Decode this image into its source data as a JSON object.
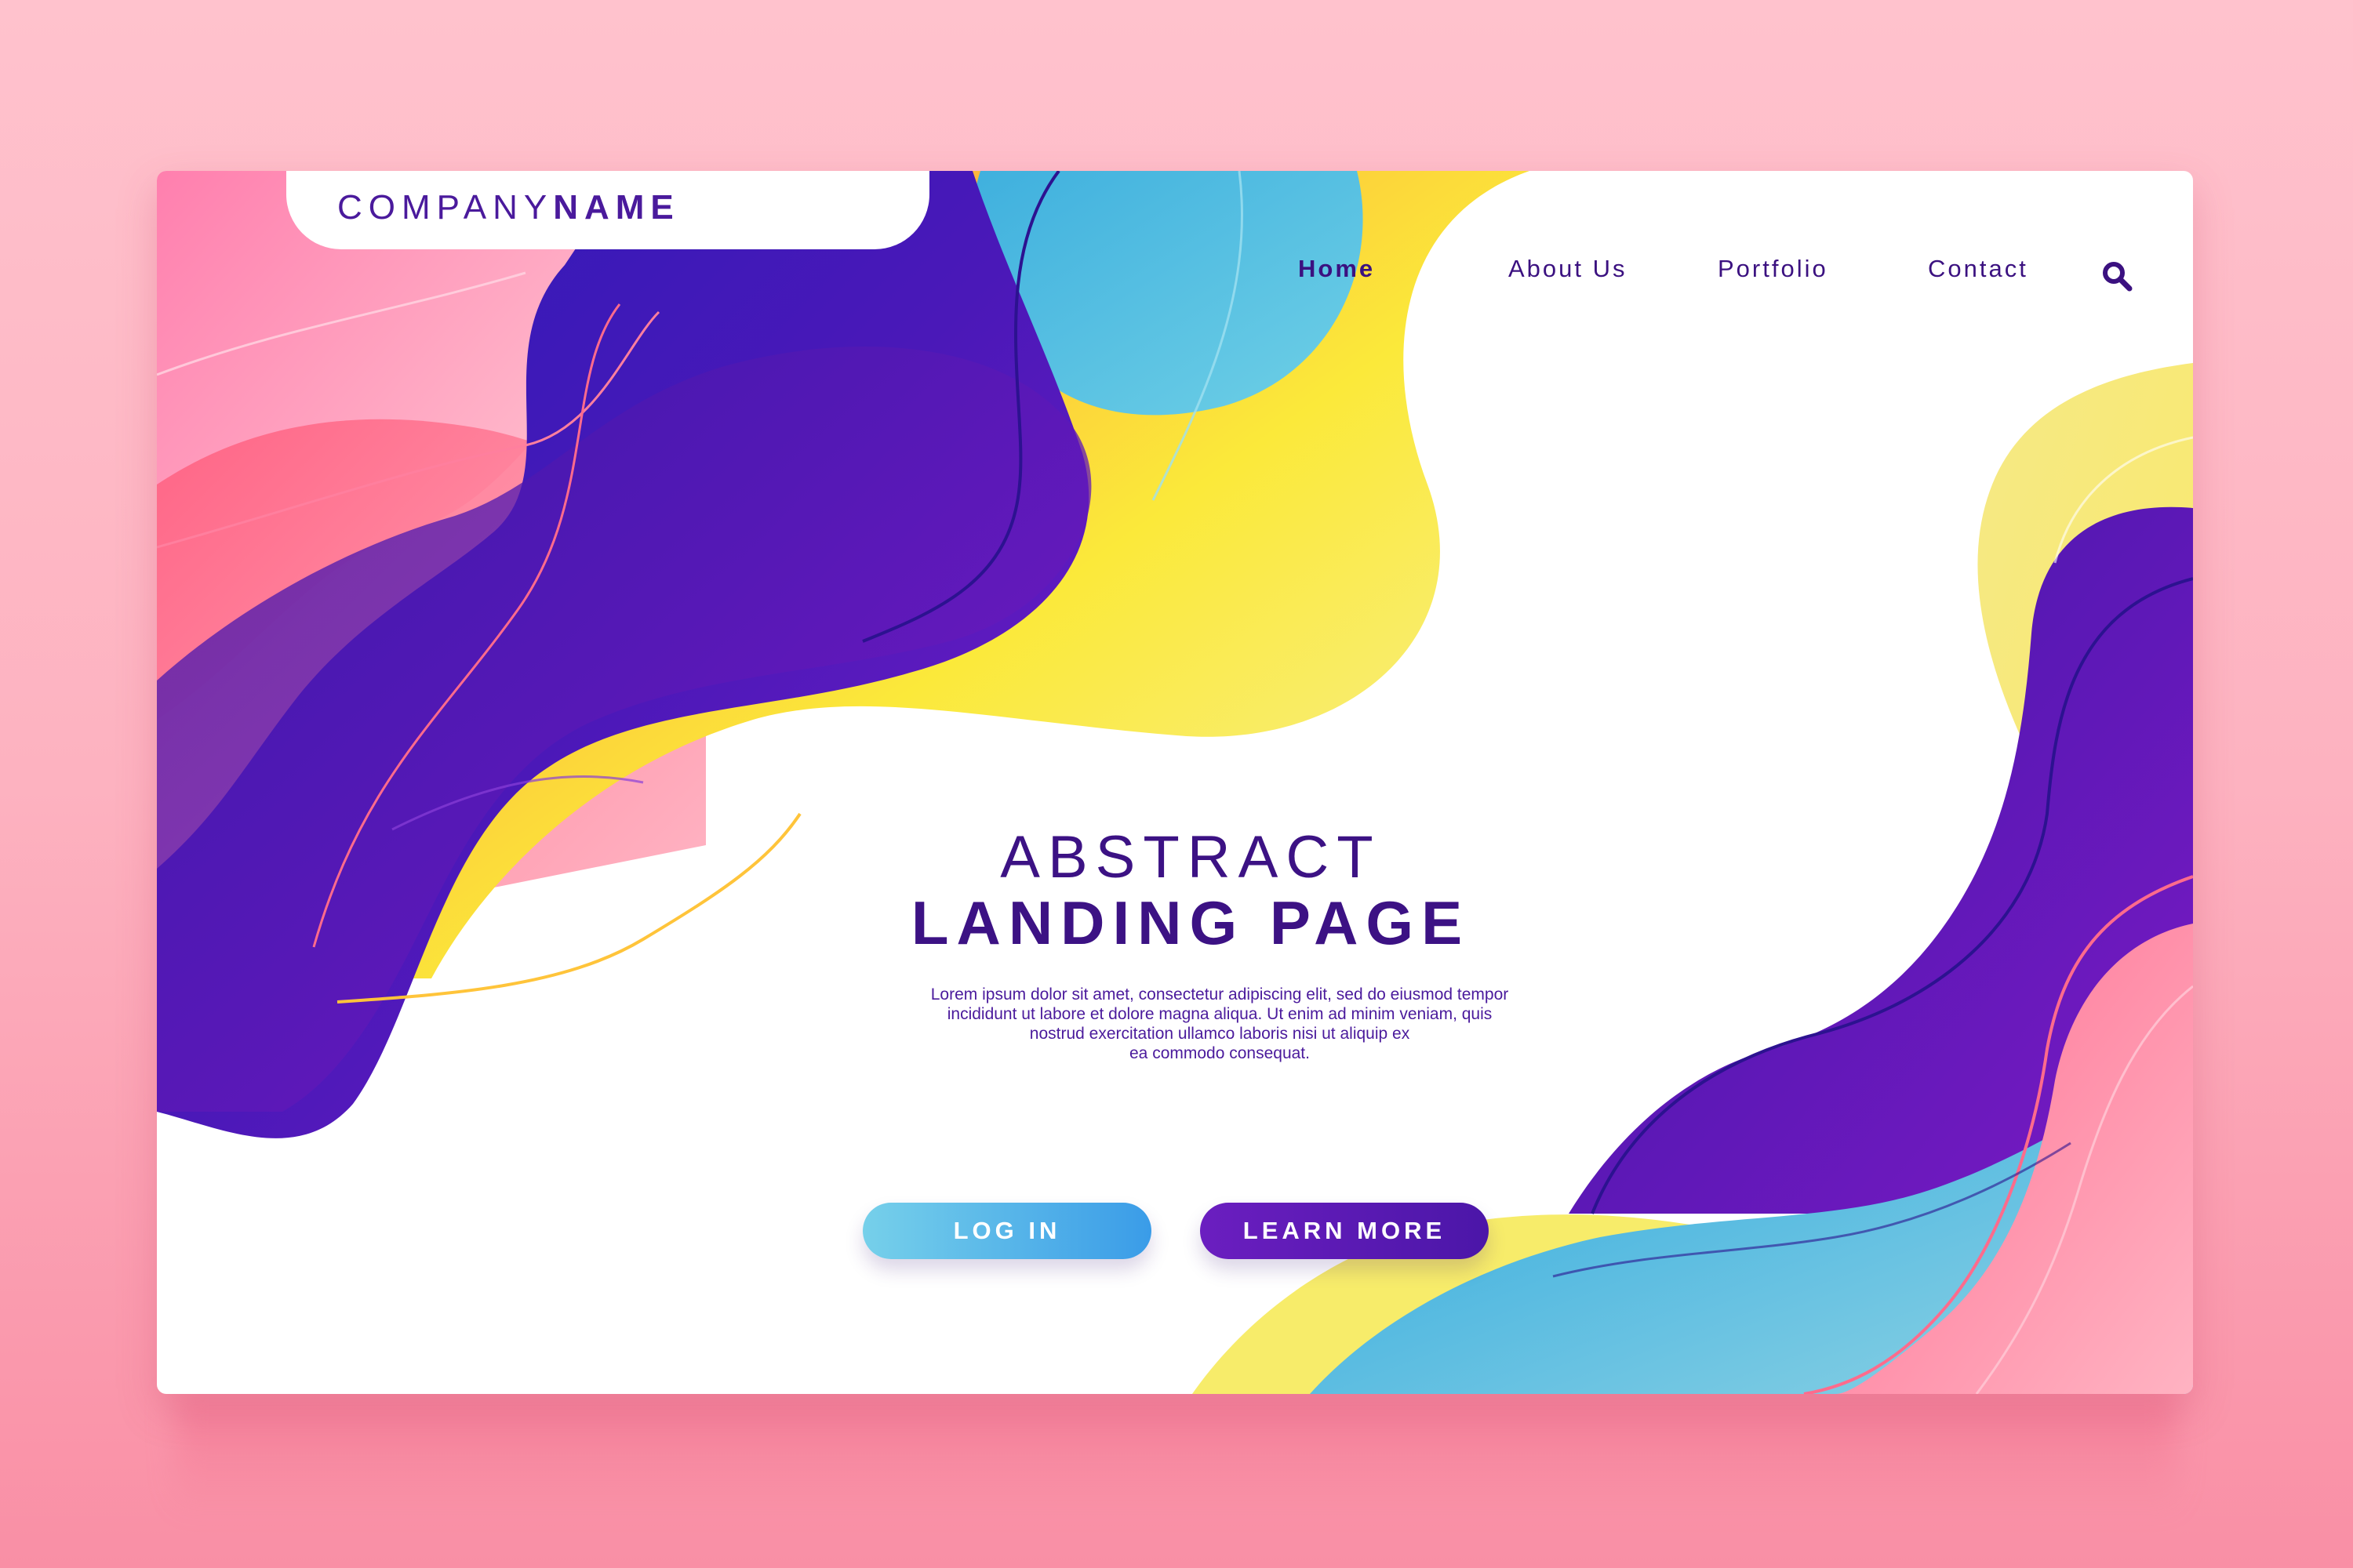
{
  "brand": {
    "light": "COMPANY",
    "bold": "NAME"
  },
  "nav": {
    "items": [
      {
        "label": "Home",
        "active": true
      },
      {
        "label": "About Us",
        "active": false
      },
      {
        "label": "Portfolio",
        "active": false
      },
      {
        "label": "Contact",
        "active": false
      }
    ],
    "search_icon": "search-icon"
  },
  "hero": {
    "title_line1": "ABSTRACT",
    "title_line2": "LANDING PAGE",
    "body_lines": [
      "Lorem ipsum dolor sit amet, consectetur adipiscing elit, sed do eiusmod tempor",
      "incididunt ut labore et dolore magna aliqua. Ut enim ad minim veniam, quis",
      "nostrud exercitation ullamco laboris nisi ut aliquip ex",
      "ea commodo consequat."
    ]
  },
  "buttons": {
    "login": "LOG IN",
    "learn_more": "LEARN MORE"
  },
  "colors": {
    "brand_purple": "#3c1284",
    "accent_violet": "#6b1ec0",
    "accent_blue": "#3a9ce8",
    "accent_yellow": "#f9e83a",
    "accent_pink": "#ff6f93",
    "page_background": "#fdb2c0"
  }
}
